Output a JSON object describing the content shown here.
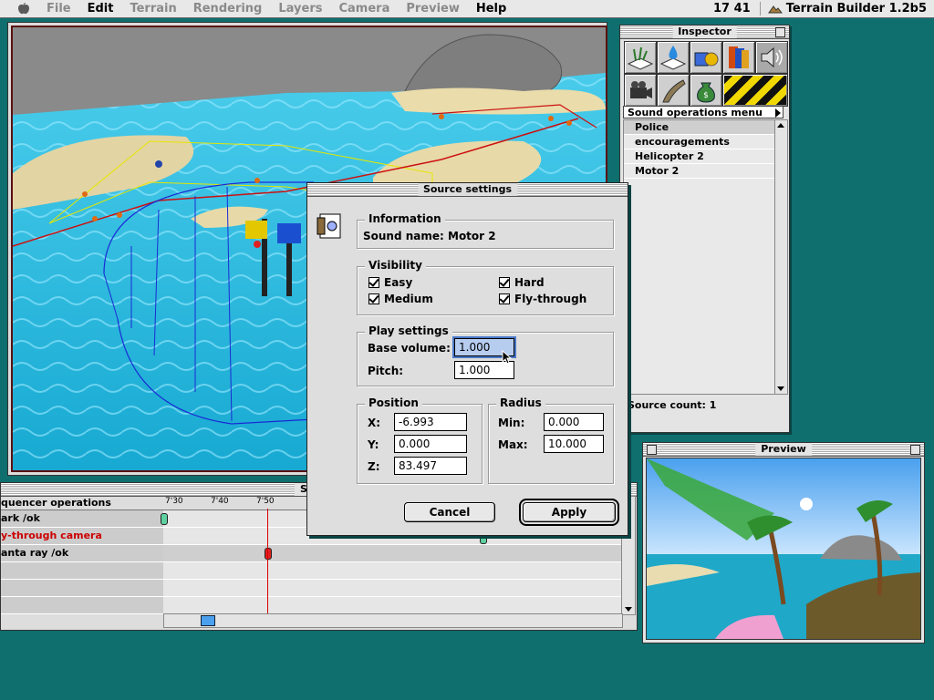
{
  "menubar": {
    "items": [
      {
        "label": "File",
        "enabled": false
      },
      {
        "label": "Edit",
        "enabled": true
      },
      {
        "label": "Terrain",
        "enabled": false
      },
      {
        "label": "Rendering",
        "enabled": false
      },
      {
        "label": "Layers",
        "enabled": false
      },
      {
        "label": "Camera",
        "enabled": false
      },
      {
        "label": "Preview",
        "enabled": false
      },
      {
        "label": "Help",
        "enabled": true
      }
    ],
    "clock": "17 41",
    "app_name": "Terrain Builder 1.2b5"
  },
  "inspector": {
    "title": "Inspector",
    "tools": [
      "plants-tile-icon",
      "water-drop-icon",
      "objects-icon",
      "textures-icon",
      "sound-icon",
      "camera-icon",
      "road-icon",
      "money-bag-icon",
      "hazard-stripes-icon"
    ],
    "menu_label": "Sound operations menu",
    "sources": [
      "Police",
      "encouragements",
      "Helicopter 2",
      "Motor 2"
    ],
    "selected_index": 0,
    "source_count": "Source count: 1"
  },
  "preview": {
    "title": "Preview"
  },
  "sequencer": {
    "title": "Seque",
    "header": "quencer operations",
    "ticks": [
      "7'30",
      "7'40",
      "7'50"
    ],
    "rows": [
      {
        "label": "ark /ok",
        "color": "#000000"
      },
      {
        "label": "y-through camera",
        "color": "#cc0000"
      },
      {
        "label": "anta ray /ok",
        "color": "#000000"
      },
      {
        "label": "",
        "color": "#000000"
      },
      {
        "label": "",
        "color": "#000000"
      },
      {
        "label": "",
        "color": "#000000"
      }
    ]
  },
  "dialog": {
    "title": "Source settings",
    "information": {
      "label": "Information",
      "sound_name": "Sound name: Motor 2"
    },
    "visibility": {
      "label": "Visibility",
      "easy": "Easy",
      "hard": "Hard",
      "medium": "Medium",
      "fly_through": "Fly-through"
    },
    "play": {
      "label": "Play settings",
      "base_volume_label": "Base volume:",
      "base_volume": "1.000",
      "pitch_label": "Pitch:",
      "pitch": "1.000"
    },
    "position": {
      "label": "Position",
      "x_label": "X:",
      "x": "-6.993",
      "y_label": "Y:",
      "y": "0.000",
      "z_label": "Z:",
      "z": "83.497"
    },
    "radius": {
      "label": "Radius",
      "min_label": "Min:",
      "min": "0.000",
      "max_label": "Max:",
      "max": "10.000"
    },
    "cancel": "Cancel",
    "apply": "Apply"
  },
  "colors": {
    "desktop": "#0f6e6e",
    "water": "#2bb7d8",
    "sand": "#e8dcb0",
    "selection": "#b6cdf0"
  }
}
